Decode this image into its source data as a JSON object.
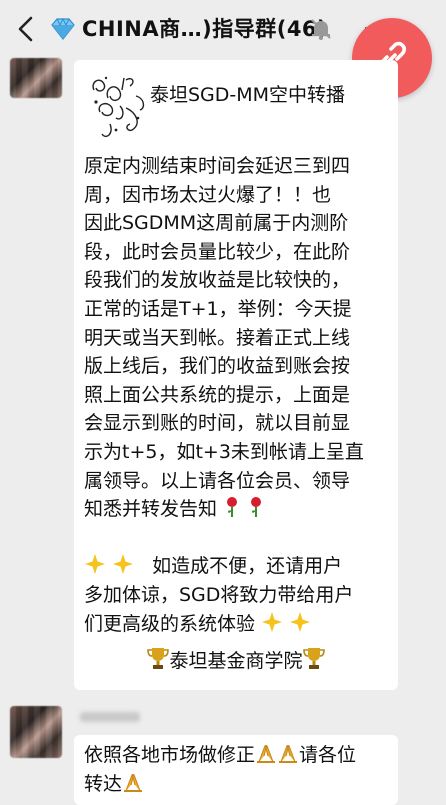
{
  "header": {
    "title": "CHINA商…)指导群(46)",
    "back_icon": "back-chevron-icon",
    "group_icon": "diamond-icon",
    "mute_icon": "muted-bell-icon",
    "more_icon": "more-dots-icon",
    "link_button_icon": "link-icon"
  },
  "messages": [
    {
      "title": "泰坦SGD-MM空中转播",
      "line1": "原定内测结束时间会延迟三到四",
      "line2": "周，因市场太过火爆了！！也",
      "line3": "因此SGDMM这周前属于内测阶",
      "line4": "段，此时会员量比较少，在此阶",
      "line5": "段我们的发放收益是比较快的，",
      "line6": "正常的话是T+1，举例：今天提",
      "line7": "明天或当天到帐。接着正式上线",
      "line8": "版上线后，我们的收益到账会按",
      "line9": "照上面公共系统的提示，上面是",
      "line10": "会显示到账的时间，就以目前显",
      "line11": "示为t+5，如t+3未到帐请上呈直",
      "line12": "属领导。以上请各位会员、领导",
      "line13": "知悉并转发告知",
      "line14": "如造成不便，还请用户",
      "line15": "多加体谅，SGD将致力带给用户",
      "line16": "们更高级的系统体验",
      "signature": "泰坦基金商学院"
    },
    {
      "line1": "依照各地市场做修正",
      "line1b": "请各位",
      "line2": "转达"
    }
  ],
  "colors": {
    "background": "#ededed",
    "bubble": "#ffffff",
    "link_button": "#f25b5b"
  }
}
